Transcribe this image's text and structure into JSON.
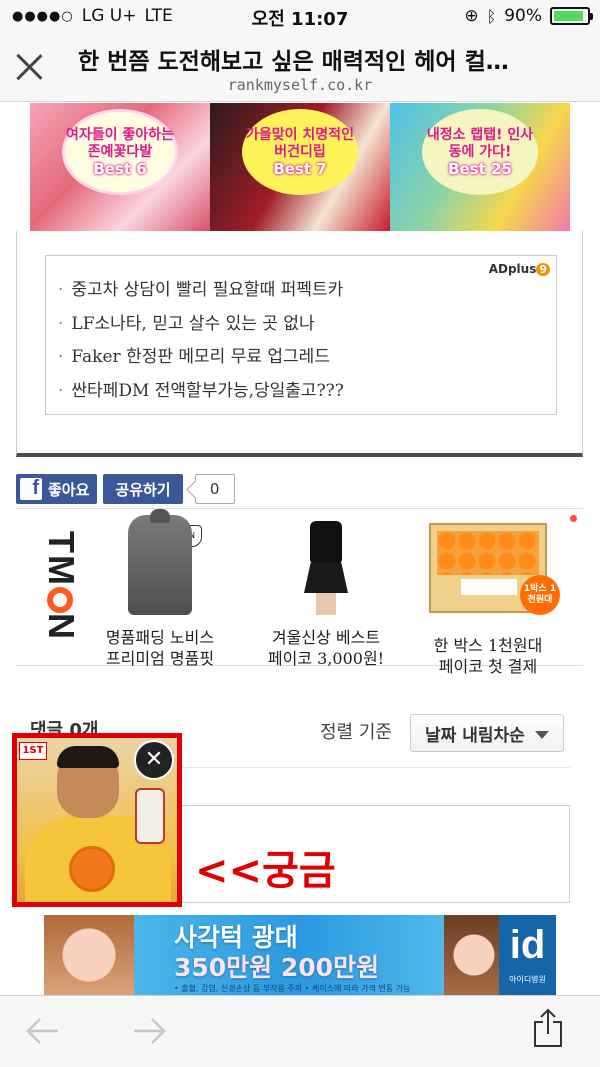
{
  "status_bar": {
    "carrier": "LG U+",
    "network": "LTE",
    "time": "오전 11:07",
    "battery_percent": "90%",
    "battery_level": 0.9,
    "battery_color": "#4cd964"
  },
  "title_bar": {
    "title": "한 번쯤 도전해보고 싶은 매력적인 헤어 컬…",
    "url": "rankmyself.co.kr"
  },
  "banner": {
    "items": [
      {
        "caption": "여자들이 좋아하는 존예꽃다발",
        "badge": "Best 6"
      },
      {
        "caption": "가을맞이 치명적인 버건디립",
        "badge": "Best 7"
      },
      {
        "caption": "내정소 랩탭! 인사동에 가다!",
        "badge": "Best 25"
      }
    ]
  },
  "text_ad": {
    "provider": "ADplus",
    "provider_suffix": "9",
    "items": [
      "중고차 상담이 빨리 필요할때 퍼펙트카",
      "LF소나타, 믿고 살수 있는 곳 없나",
      "Faker 한정판 메모리 무료 업그레드",
      "싼타페DM 전액할부가능,당일출고???"
    ]
  },
  "facebook": {
    "like_label": "좋아요",
    "share_label": "공유하기",
    "share_count": "0",
    "color": "#3b5998"
  },
  "tmon": {
    "logo": "TMON",
    "products": [
      {
        "line1": "명품패딩 노비스",
        "line2": "프리미엄 명품핏"
      },
      {
        "line1": "겨울신상 베스트",
        "line2": "페이코 3,000원!"
      },
      {
        "line1": "한 박스 1천원대",
        "line2": "페이코 첫 결제"
      }
    ],
    "badge_text": "1박스 1천원대",
    "accent": "#ff5a1f"
  },
  "comments": {
    "heading": "댓글 0개",
    "sort_label": "정렬 기준",
    "sort_value": "날짜 내림차순"
  },
  "annotation": {
    "text": "<<궁금",
    "color": "#e00000"
  },
  "float_ad": {
    "tag": "1ST",
    "close": "✕"
  },
  "bottom_banner": {
    "line1": "사각턱 광대",
    "line2": "350만원 200만원",
    "fine_print": "• 출혈, 감염, 신경손상 등 부작용 주의 • 케이스에 따라 가격 변동 가능",
    "logo": "id",
    "logo_sub": "아이디병원"
  }
}
